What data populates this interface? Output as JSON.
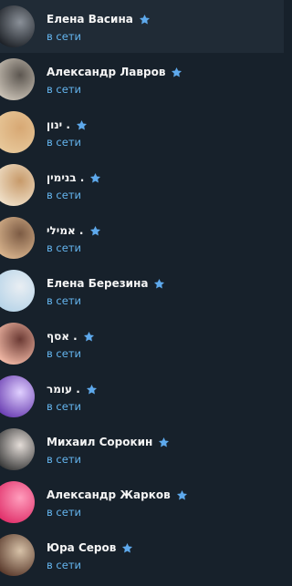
{
  "colors": {
    "background": "#17212b",
    "selected_row": "#202b36",
    "name_text": "#f5f5f5",
    "status_text": "#64b5ef",
    "star": "#5ea9ec"
  },
  "contacts": [
    {
      "name": "Елена Васина",
      "status": "в сети",
      "selected": true,
      "avatar_icon": "car-photo-avatar",
      "avatar_colors": [
        "#1d2127",
        "#8a9098"
      ]
    },
    {
      "name": "Александр Лавров",
      "status": "в сети",
      "selected": false,
      "avatar_icon": "person-photo-avatar",
      "avatar_colors": [
        "#c9c1b5",
        "#5c5650"
      ]
    },
    {
      "name": "ינון .",
      "status": "в сети",
      "selected": false,
      "avatar_icon": "person-photo-avatar",
      "avatar_colors": [
        "#e8c89a",
        "#d7a874"
      ]
    },
    {
      "name": "בנימין .",
      "status": "в сети",
      "selected": false,
      "avatar_icon": "person-photo-avatar",
      "avatar_colors": [
        "#f0e0c8",
        "#c79a6a"
      ]
    },
    {
      "name": "אמילי .",
      "status": "в сети",
      "selected": false,
      "avatar_icon": "person-photo-avatar",
      "avatar_colors": [
        "#d9b48d",
        "#7c5b44"
      ]
    },
    {
      "name": "Елена Березина",
      "status": "в сети",
      "selected": false,
      "avatar_icon": "person-photo-avatar",
      "avatar_colors": [
        "#b7d4e8",
        "#e9eef3"
      ]
    },
    {
      "name": "אסף .",
      "status": "в сети",
      "selected": false,
      "avatar_icon": "person-photo-avatar",
      "avatar_colors": [
        "#f2b9a6",
        "#6b3a34"
      ]
    },
    {
      "name": "עומר .",
      "status": "в сети",
      "selected": false,
      "avatar_icon": "person-photo-avatar",
      "avatar_colors": [
        "#6b3fb2",
        "#e0d0ff"
      ]
    },
    {
      "name": "Михаил Сорокин",
      "status": "в сети",
      "selected": false,
      "avatar_icon": "person-photo-avatar",
      "avatar_colors": [
        "#3a3a3a",
        "#e4ddd8"
      ]
    },
    {
      "name": "Александр Жарков",
      "status": "в сети",
      "selected": false,
      "avatar_icon": "person-photo-avatar",
      "avatar_colors": [
        "#e0306a",
        "#ff9ebd"
      ]
    },
    {
      "name": "Юра Серов",
      "status": "в сети",
      "selected": false,
      "avatar_icon": "person-photo-avatar",
      "avatar_colors": [
        "#5a3a2c",
        "#d7c2a8"
      ]
    }
  ]
}
